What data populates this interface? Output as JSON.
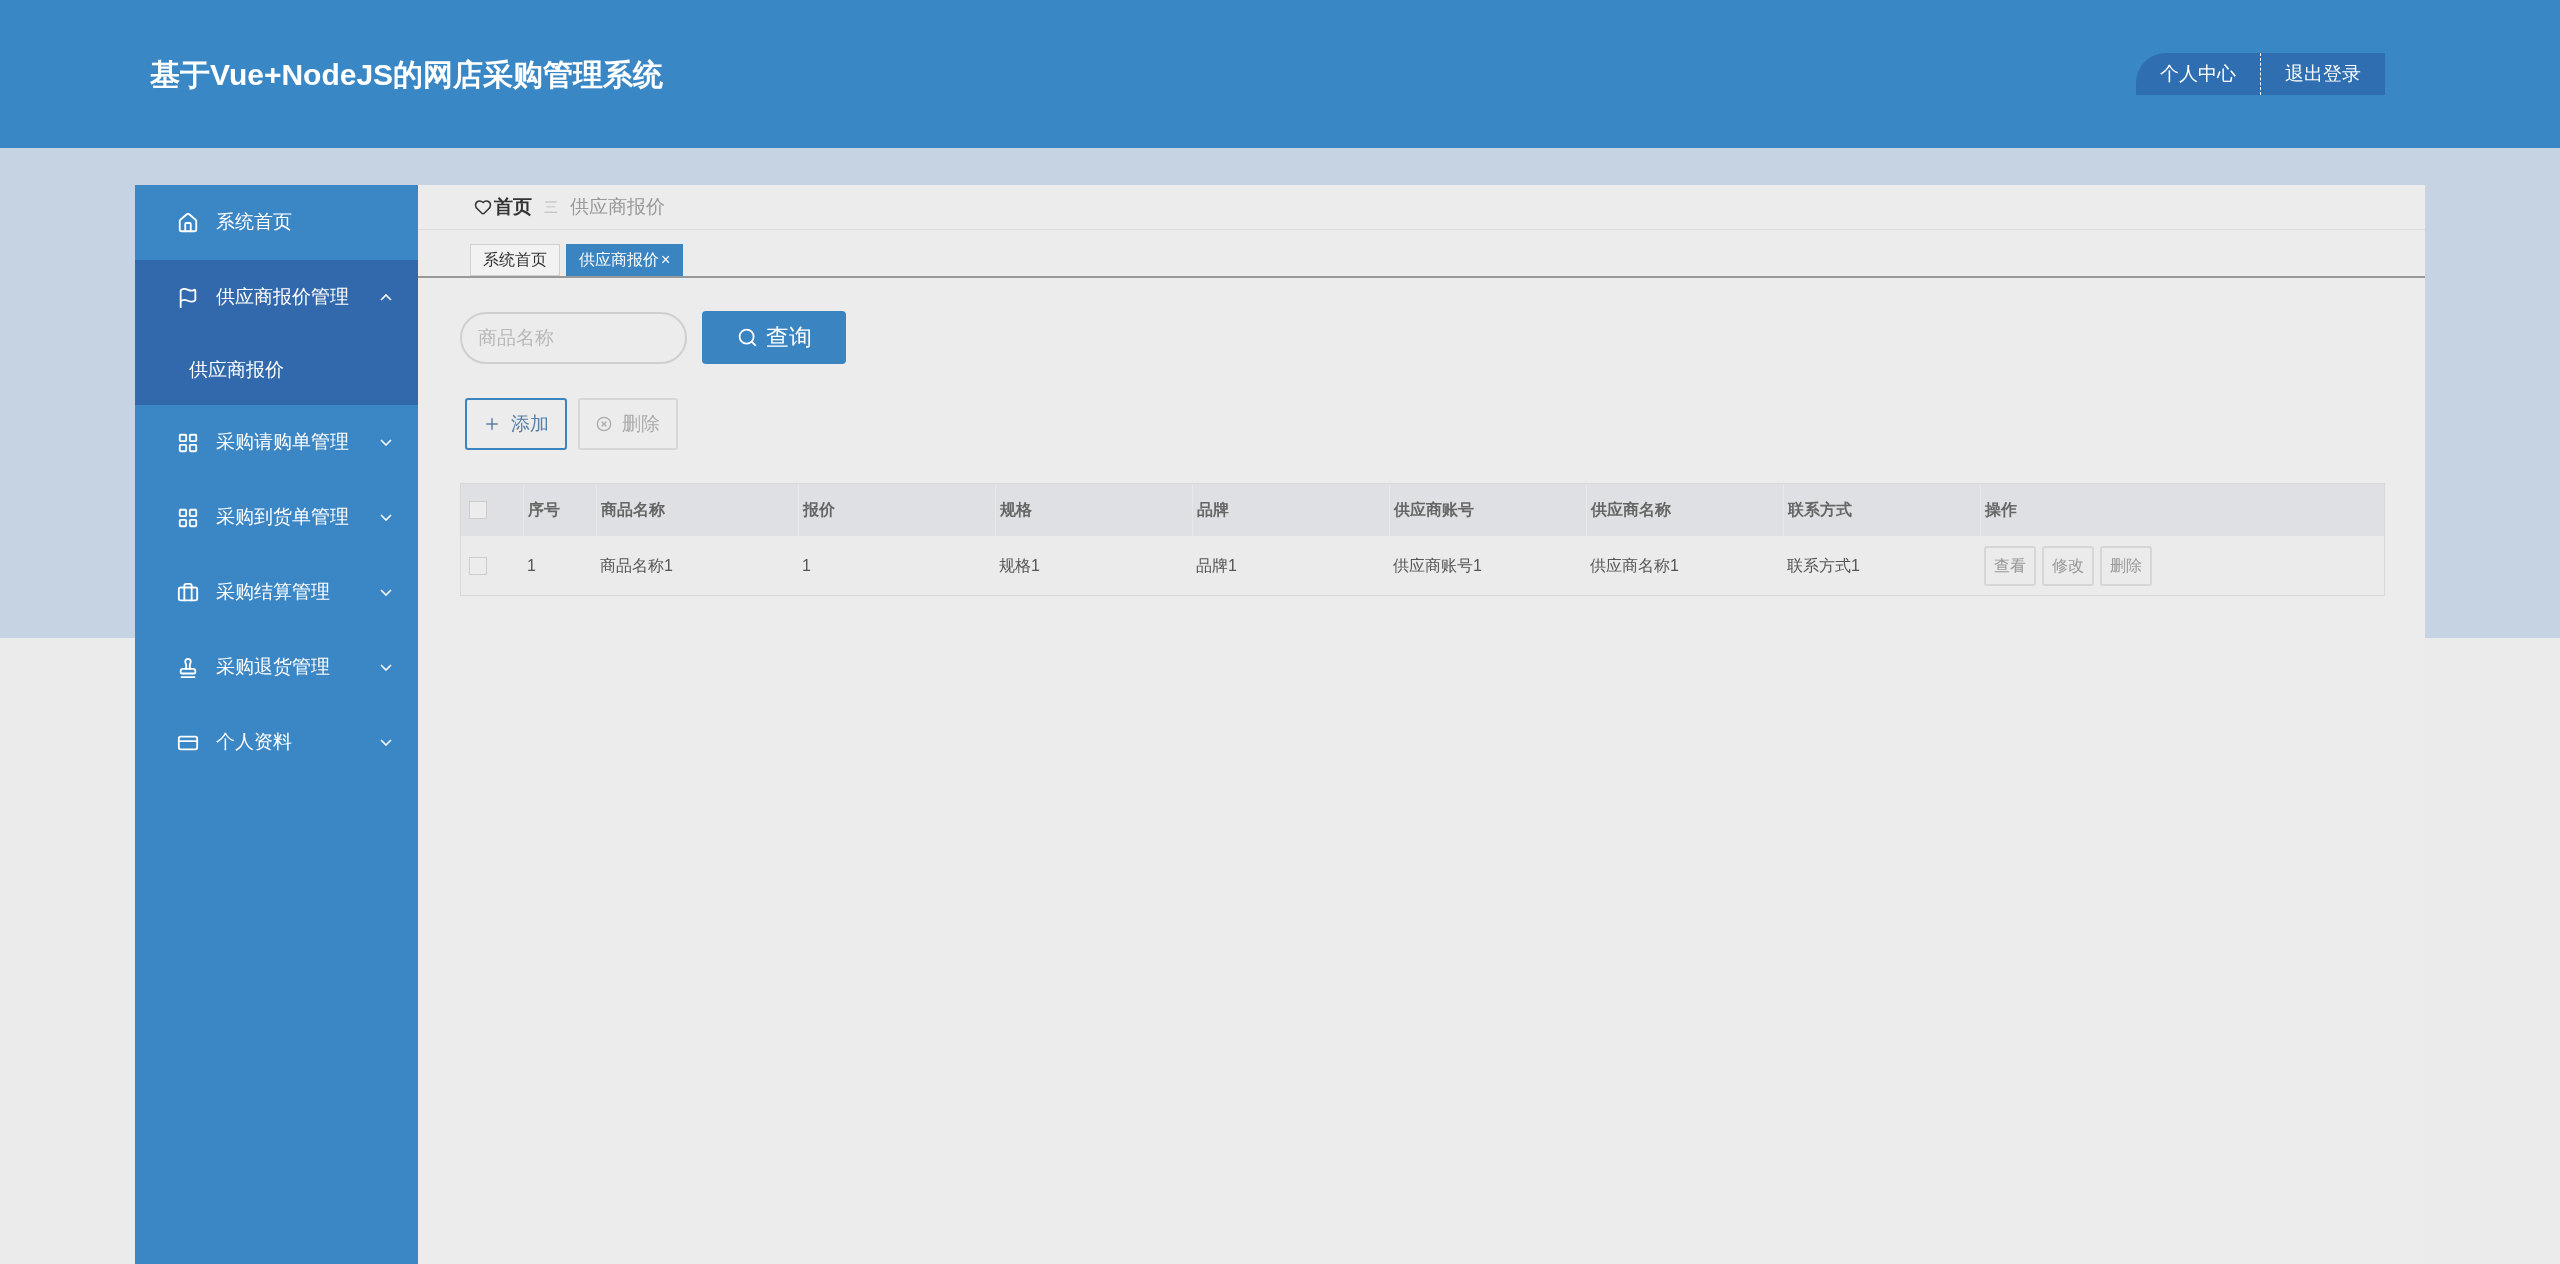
{
  "header": {
    "title": "基于Vue+NodeJS的网店采购管理系统",
    "links": [
      "个人中心",
      "退出登录"
    ]
  },
  "sidebar": {
    "items": [
      {
        "label": "系统首页",
        "expanded": false
      },
      {
        "label": "供应商报价管理",
        "expanded": true,
        "children": [
          {
            "label": "供应商报价",
            "selected": true
          }
        ]
      },
      {
        "label": "采购请购单管理",
        "expanded": false
      },
      {
        "label": "采购到货单管理",
        "expanded": false
      },
      {
        "label": "采购结算管理",
        "expanded": false
      },
      {
        "label": "采购退货管理",
        "expanded": false
      },
      {
        "label": "个人资料",
        "expanded": false
      }
    ]
  },
  "breadcrumb": {
    "home": "首页",
    "separator": "三",
    "current": "供应商报价"
  },
  "tabs": [
    {
      "label": "系统首页",
      "selected": false
    },
    {
      "label": "供应商报价",
      "selected": true,
      "close": "×"
    }
  ],
  "search": {
    "placeholder": "商品名称",
    "button": "查询"
  },
  "actions": [
    {
      "label": "添加",
      "kind": "add",
      "disabled": false
    },
    {
      "label": "删除",
      "kind": "delete",
      "disabled": true
    }
  ],
  "table": {
    "all_checked": false,
    "columns": [
      "序号",
      "商品名称",
      "报价",
      "规格",
      "品牌",
      "供应商账号",
      "供应商名称",
      "联系方式",
      "操作"
    ],
    "rows": [
      {
        "checked": false,
        "cells": [
          "1",
          "商品名称1",
          "1",
          "规格1",
          "品牌1",
          "供应商账号1",
          "供应商名称1",
          "联系方式1"
        ],
        "buttons": [
          "查看",
          "修改",
          "删除"
        ]
      }
    ]
  }
}
